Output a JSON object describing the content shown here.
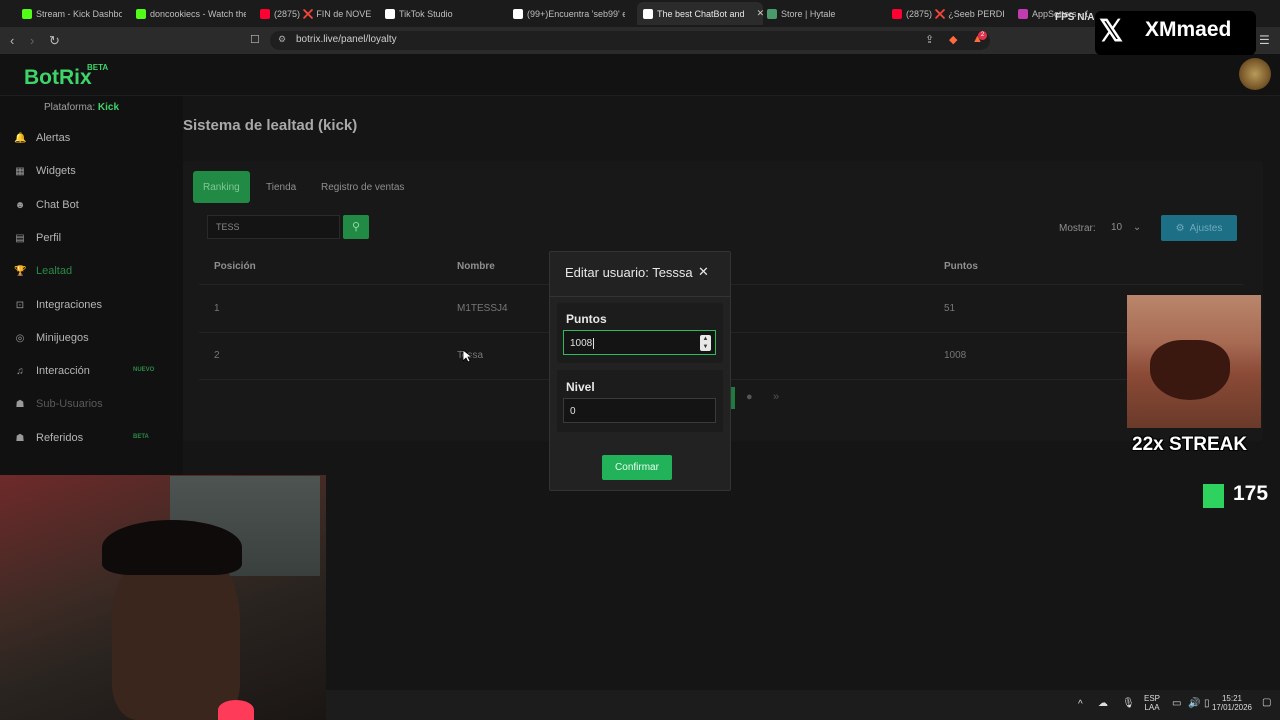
{
  "browser": {
    "tabs": [
      {
        "label": "Stream - Kick Dashboa",
        "color": "#53fc18"
      },
      {
        "label": "doncookiecs - Watch the V",
        "color": "#53fc18"
      },
      {
        "label": "(2875) ❌ FIN de NOVELA",
        "color": "#ff0033"
      },
      {
        "label": "TikTok Studio",
        "color": "#ffffff"
      },
      {
        "label": "(99+)Encuentra 'seb99' en",
        "color": "#ffffff"
      },
      {
        "label": "The best ChatBot and",
        "color": "#ffffff",
        "active": true
      },
      {
        "label": "Store | Hytale",
        "color": "#4a9a6a"
      },
      {
        "label": "(2875) ❌ ¿Seeb PERDI",
        "color": "#ff0033"
      },
      {
        "label": "AppSotters - C",
        "color": "#c03cb0"
      }
    ],
    "url": "botrix.live/panel/loyalty",
    "tab_close": "✕",
    "overlay_badge": "2"
  },
  "brand": {
    "name": "BotRix",
    "badge": "BETA",
    "platform_label": "Plataforma:",
    "platform_value": "Kick"
  },
  "sidebar": {
    "items": [
      {
        "label": "Alertas",
        "icon": "bell-icon"
      },
      {
        "label": "Widgets",
        "icon": "grid-icon"
      },
      {
        "label": "Chat Bot",
        "icon": "robot-icon"
      },
      {
        "label": "Perfil",
        "icon": "id-card-icon"
      },
      {
        "label": "Lealtad",
        "icon": "trophy-icon",
        "active": true
      },
      {
        "label": "Integraciones",
        "icon": "plug-icon"
      },
      {
        "label": "Minijuegos",
        "icon": "gamepad-icon"
      },
      {
        "label": "Interacción",
        "icon": "music-icon",
        "badge": "NUEVO"
      },
      {
        "label": "Sub-Usuarios",
        "icon": "users-icon",
        "dim": true
      },
      {
        "label": "Referidos",
        "icon": "people-icon",
        "badge": "BETA"
      }
    ]
  },
  "page": {
    "title": "Sistema de lealtad (kick)",
    "tabs": [
      "Ranking",
      "Tienda",
      "Registro de ventas"
    ],
    "search_value": "TESS",
    "show_label": "Mostrar:",
    "show_value": "10",
    "settings_label": "Ajustes",
    "table": {
      "headers": [
        "Posición",
        "Nombre",
        "Puntos"
      ],
      "rows": [
        {
          "position": "1",
          "name": "M1TESSJ4",
          "points": "51"
        },
        {
          "position": "2",
          "name": "Tessa",
          "points": "1008"
        }
      ]
    }
  },
  "modal": {
    "title": "Editar usuario: Tesssa",
    "close": "✕",
    "points_label": "Puntos",
    "points_value": "1008",
    "level_label": "Nivel",
    "level_value": "0",
    "confirm_label": "Confirmar"
  },
  "overlay": {
    "streak_text": "22x STREAK",
    "kick_count": "175",
    "x_name": "XMmaed",
    "fps_label": "FPS",
    "fps_value": "N/A"
  },
  "taskbar": {
    "lang": "ESP",
    "layout": "LAA",
    "time": "15:21",
    "date": "17/01/2026"
  }
}
